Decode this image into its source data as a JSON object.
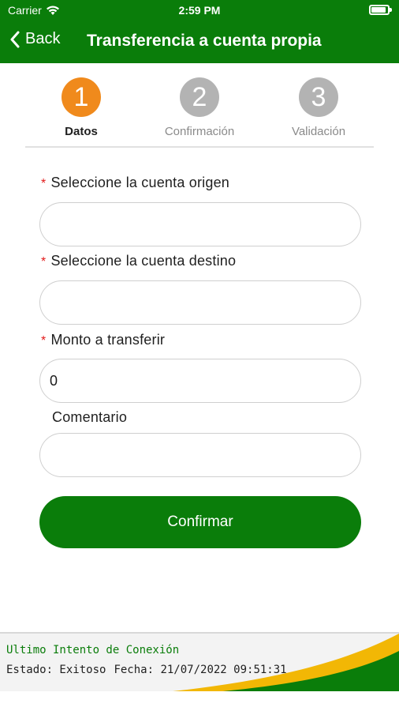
{
  "status_bar": {
    "carrier": "Carrier",
    "time": "2:59 PM"
  },
  "nav": {
    "back_label": "Back",
    "title": "Transferencia a cuenta propia"
  },
  "colors": {
    "brand_green": "#0a7d0a",
    "step_active": "#f08a1c",
    "step_inactive": "#b3b3b3",
    "required": "#e21b1b",
    "footer_accent": "#f2b705"
  },
  "stepper": {
    "steps": [
      {
        "number": "1",
        "label": "Datos",
        "active": true
      },
      {
        "number": "2",
        "label": "Confirmación",
        "active": false
      },
      {
        "number": "3",
        "label": "Validación",
        "active": false
      }
    ]
  },
  "form": {
    "origin": {
      "label": "Seleccione la cuenta origen",
      "value": "",
      "required": true
    },
    "destination": {
      "label": "Seleccione la cuenta destino",
      "value": "",
      "required": true
    },
    "amount": {
      "label": "Monto a transferir",
      "value": "0",
      "required": true
    },
    "comment": {
      "label": "Comentario",
      "value": "",
      "required": false
    },
    "required_mark": "*",
    "confirm_label": "Confirmar"
  },
  "footer": {
    "title": "Ultimo Intento de Conexión",
    "status": "Estado: Exitoso",
    "date": "Fecha: 21/07/2022 09:51:31"
  }
}
